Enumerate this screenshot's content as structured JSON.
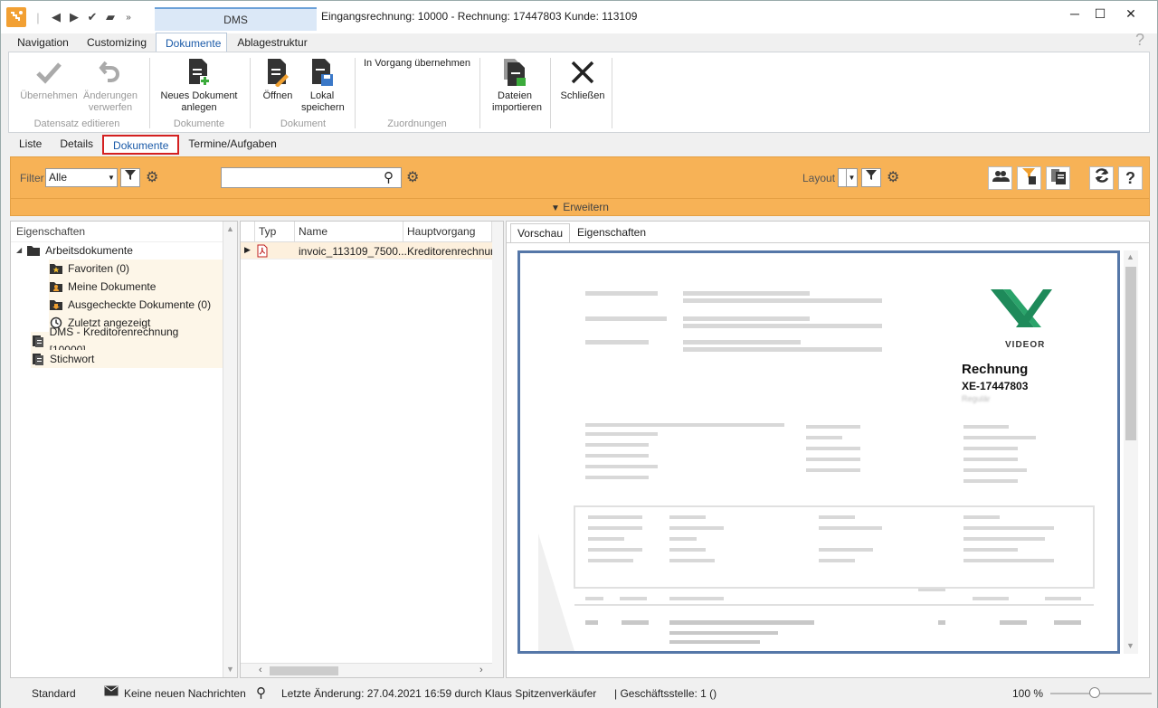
{
  "app": {
    "context_tab": "DMS",
    "window_title": "Eingangsrechnung: 10000 - Rechnung: 17447803 Kunde: 113109",
    "help_glyph": "?"
  },
  "ribbon_tabs": [
    "Navigation",
    "Customizing",
    "Dokumente",
    "Ablagestruktur"
  ],
  "ribbon": {
    "buttons": [
      {
        "label": "Übernehmen",
        "icon": "check-icon",
        "enabled": false
      },
      {
        "label": "Änderungen verwerfen",
        "icon": "undo-icon",
        "enabled": false
      },
      {
        "label": "Neues Dokument anlegen",
        "icon": "new-document-icon",
        "enabled": true
      },
      {
        "label": "Öffnen",
        "icon": "open-document-icon",
        "enabled": true
      },
      {
        "label": "Lokal speichern",
        "icon": "save-document-icon",
        "enabled": true
      },
      {
        "label": "In Vorgang übernehmen",
        "enabled": true
      },
      {
        "label": "Dateien importieren",
        "icon": "import-files-icon",
        "enabled": true
      },
      {
        "label": "Schließen",
        "icon": "close-icon",
        "enabled": true
      }
    ],
    "groups": [
      "Datensatz editieren",
      "Dokumente",
      "Dokument",
      "Zuordnungen"
    ]
  },
  "view_tabs": [
    "Liste",
    "Details",
    "Dokumente",
    "Termine/Aufgaben"
  ],
  "filter": {
    "label": "Filter",
    "value": "Alle",
    "search_value": "",
    "layout_label": "Layout",
    "layout_value": "",
    "expand_label": "Erweitern"
  },
  "tree": {
    "header": "Eigenschaften",
    "items": [
      {
        "label": "Arbeitsdokumente",
        "icon": "folder-icon",
        "level": 0
      },
      {
        "label": "Favoriten (0)",
        "icon": "star-folder-icon",
        "level": 1
      },
      {
        "label": "Meine Dokumente",
        "icon": "user-folder-icon",
        "level": 1
      },
      {
        "label": "Ausgecheckte Dokumente (0)",
        "icon": "checkout-folder-icon",
        "level": 1
      },
      {
        "label": "Zuletzt angezeigt",
        "icon": "clock-icon",
        "level": 1
      },
      {
        "label": "DMS - Kreditorenrechnung [10000]...",
        "icon": "document-list-icon",
        "level": 0
      },
      {
        "label": "Stichwort",
        "icon": "document-list-icon",
        "level": 0
      }
    ]
  },
  "grid": {
    "columns": [
      "Typ",
      "Name",
      "Hauptvorgang"
    ],
    "rows": [
      {
        "type_icon": "pdf-icon",
        "name": "invoic_113109_7500...",
        "hauptvorgang": "Kreditorenrechnun"
      }
    ]
  },
  "preview": {
    "tabs": [
      "Vorschau",
      "Eigenschaften"
    ],
    "brand": "VIDEOR",
    "doc_title": "Rechnung",
    "doc_number": "XE-17447803",
    "doc_sub": "Regulär"
  },
  "status": {
    "mode": "Standard",
    "messages": "Keine neuen Nachrichten",
    "last_change": "Letzte Änderung: 27.04.2021 16:59 durch Klaus Spitzenverkäufer",
    "office": "| Geschäftsstelle:  1 ()",
    "zoom": "100 %"
  },
  "colors": {
    "filter_bar": "#f7b256",
    "accent_blue": "#1a5aa8",
    "highlight_red": "#d42020",
    "preview_border": "#5577a8"
  }
}
